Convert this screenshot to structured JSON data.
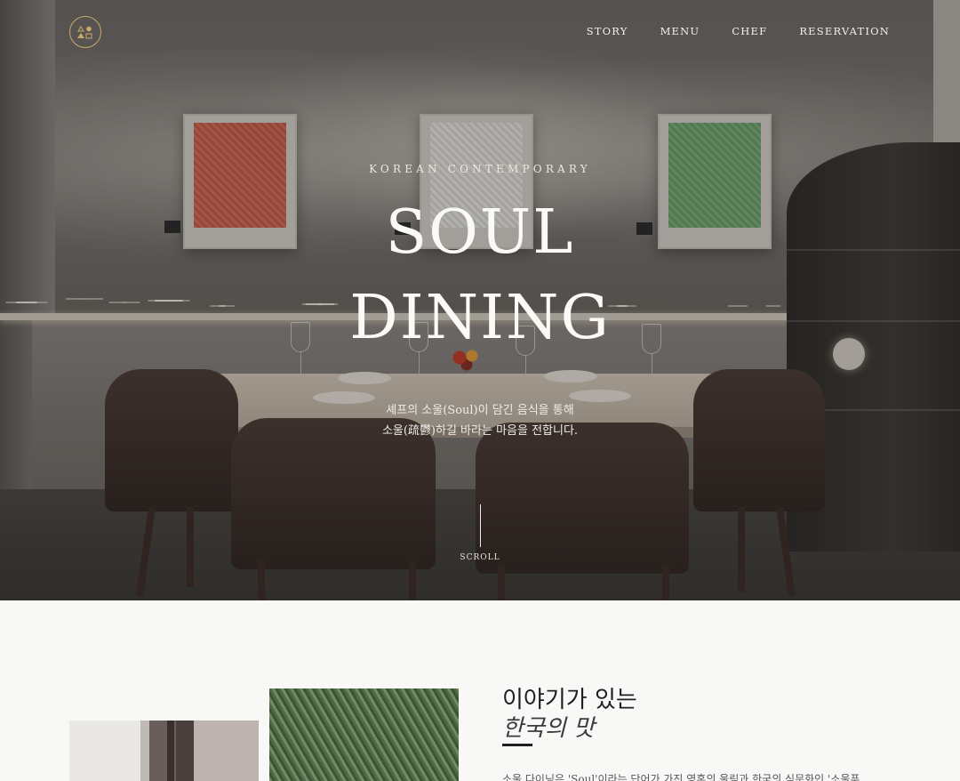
{
  "brand": {
    "logo_name": "soul-dining-logo",
    "accent_color": "#c9a96a"
  },
  "nav": {
    "items": [
      {
        "label": "STORY"
      },
      {
        "label": "MENU"
      },
      {
        "label": "CHEF"
      },
      {
        "label": "RESERVATION"
      }
    ]
  },
  "hero": {
    "eyebrow": "KOREAN CONTEMPORARY",
    "title_line1": "SOUL",
    "title_line2": "DINING",
    "tagline_line1": "셰프의 소울(Soul)이 담긴 음식을 통해",
    "tagline_line2": "소울(疏鬱)하길 바라는 마음을 전합니다.",
    "scroll_label": "SCROLL"
  },
  "story": {
    "heading_line1": "이야기가 있는",
    "heading_line2": "한국의 맛",
    "body": "소울 다이닝은 'Soul'이라는 단어가 가진 영혼의 울림과 한국의 식문화인 '소울푸"
  }
}
